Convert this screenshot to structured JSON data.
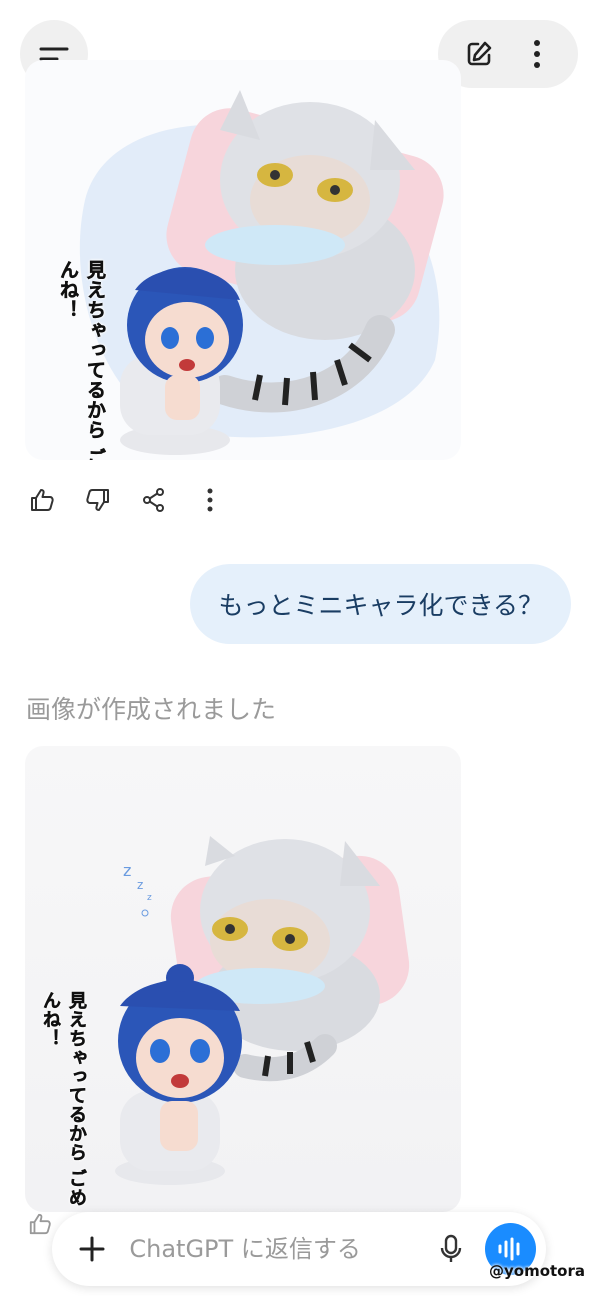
{
  "conversation": {
    "image1": {
      "caption": "見えちゃってるから ごめんね！"
    },
    "user_message": "もっとミニキャラ化できる？",
    "status_text": "画像が作成されました",
    "image2": {
      "caption": "見えちゃってるから ごめんね！",
      "zzz": "z z z"
    }
  },
  "composer": {
    "placeholder": "ChatGPT に返信する"
  },
  "watermark": "@yomotora",
  "icons": {
    "menu": "menu-icon",
    "new_chat": "edit-icon",
    "more": "more-vertical-icon",
    "like": "thumbs-up-icon",
    "dislike": "thumbs-down-icon",
    "share": "share-icon",
    "plus": "plus-icon",
    "mic": "microphone-icon",
    "voice": "voice-mode-icon"
  },
  "colors": {
    "user_bubble": "#e5f0fb",
    "user_text": "#1a3d63",
    "voice_button": "#1a8cff",
    "topbar_button": "#f0f0f0"
  }
}
